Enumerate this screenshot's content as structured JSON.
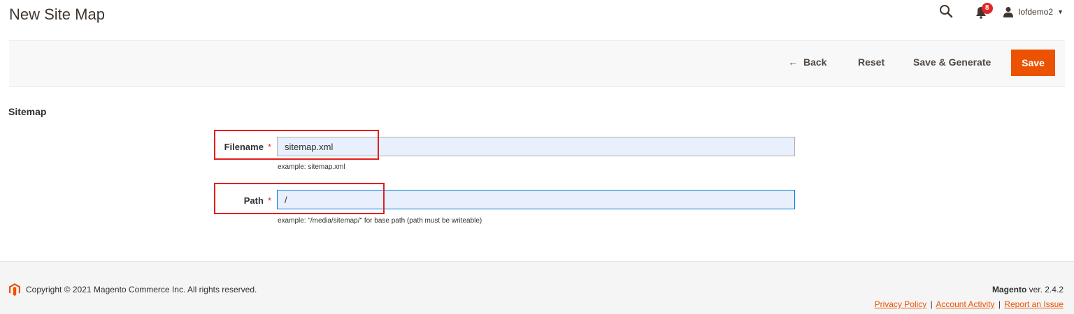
{
  "header": {
    "title": "New Site Map",
    "notifications_count": "8",
    "user_name": "lofdemo2",
    "icons": [
      "search-icon",
      "bell-icon",
      "user-icon",
      "caret-down-icon"
    ]
  },
  "toolbar": {
    "back_label": "Back",
    "reset_label": "Reset",
    "save_generate_label": "Save & Generate",
    "save_label": "Save"
  },
  "form": {
    "section_title": "Sitemap",
    "filename": {
      "label": "Filename",
      "required_mark": "*",
      "value": "sitemap.xml",
      "note": "example: sitemap.xml"
    },
    "path": {
      "label": "Path",
      "required_mark": "*",
      "value": "/",
      "note": "example: \"/media/sitemap/\" for base path (path must be writeable)"
    }
  },
  "footer": {
    "copyright": "Copyright © 2021 Magento Commerce Inc. All rights reserved.",
    "brand": "Magento",
    "version": "ver. 2.4.2",
    "links": {
      "privacy": "Privacy Policy",
      "activity": "Account Activity",
      "report": "Report an Issue"
    },
    "separator": "|"
  },
  "colors": {
    "accent": "#eb5202",
    "highlight_box": "#e31d1d",
    "badge": "#e22626"
  }
}
